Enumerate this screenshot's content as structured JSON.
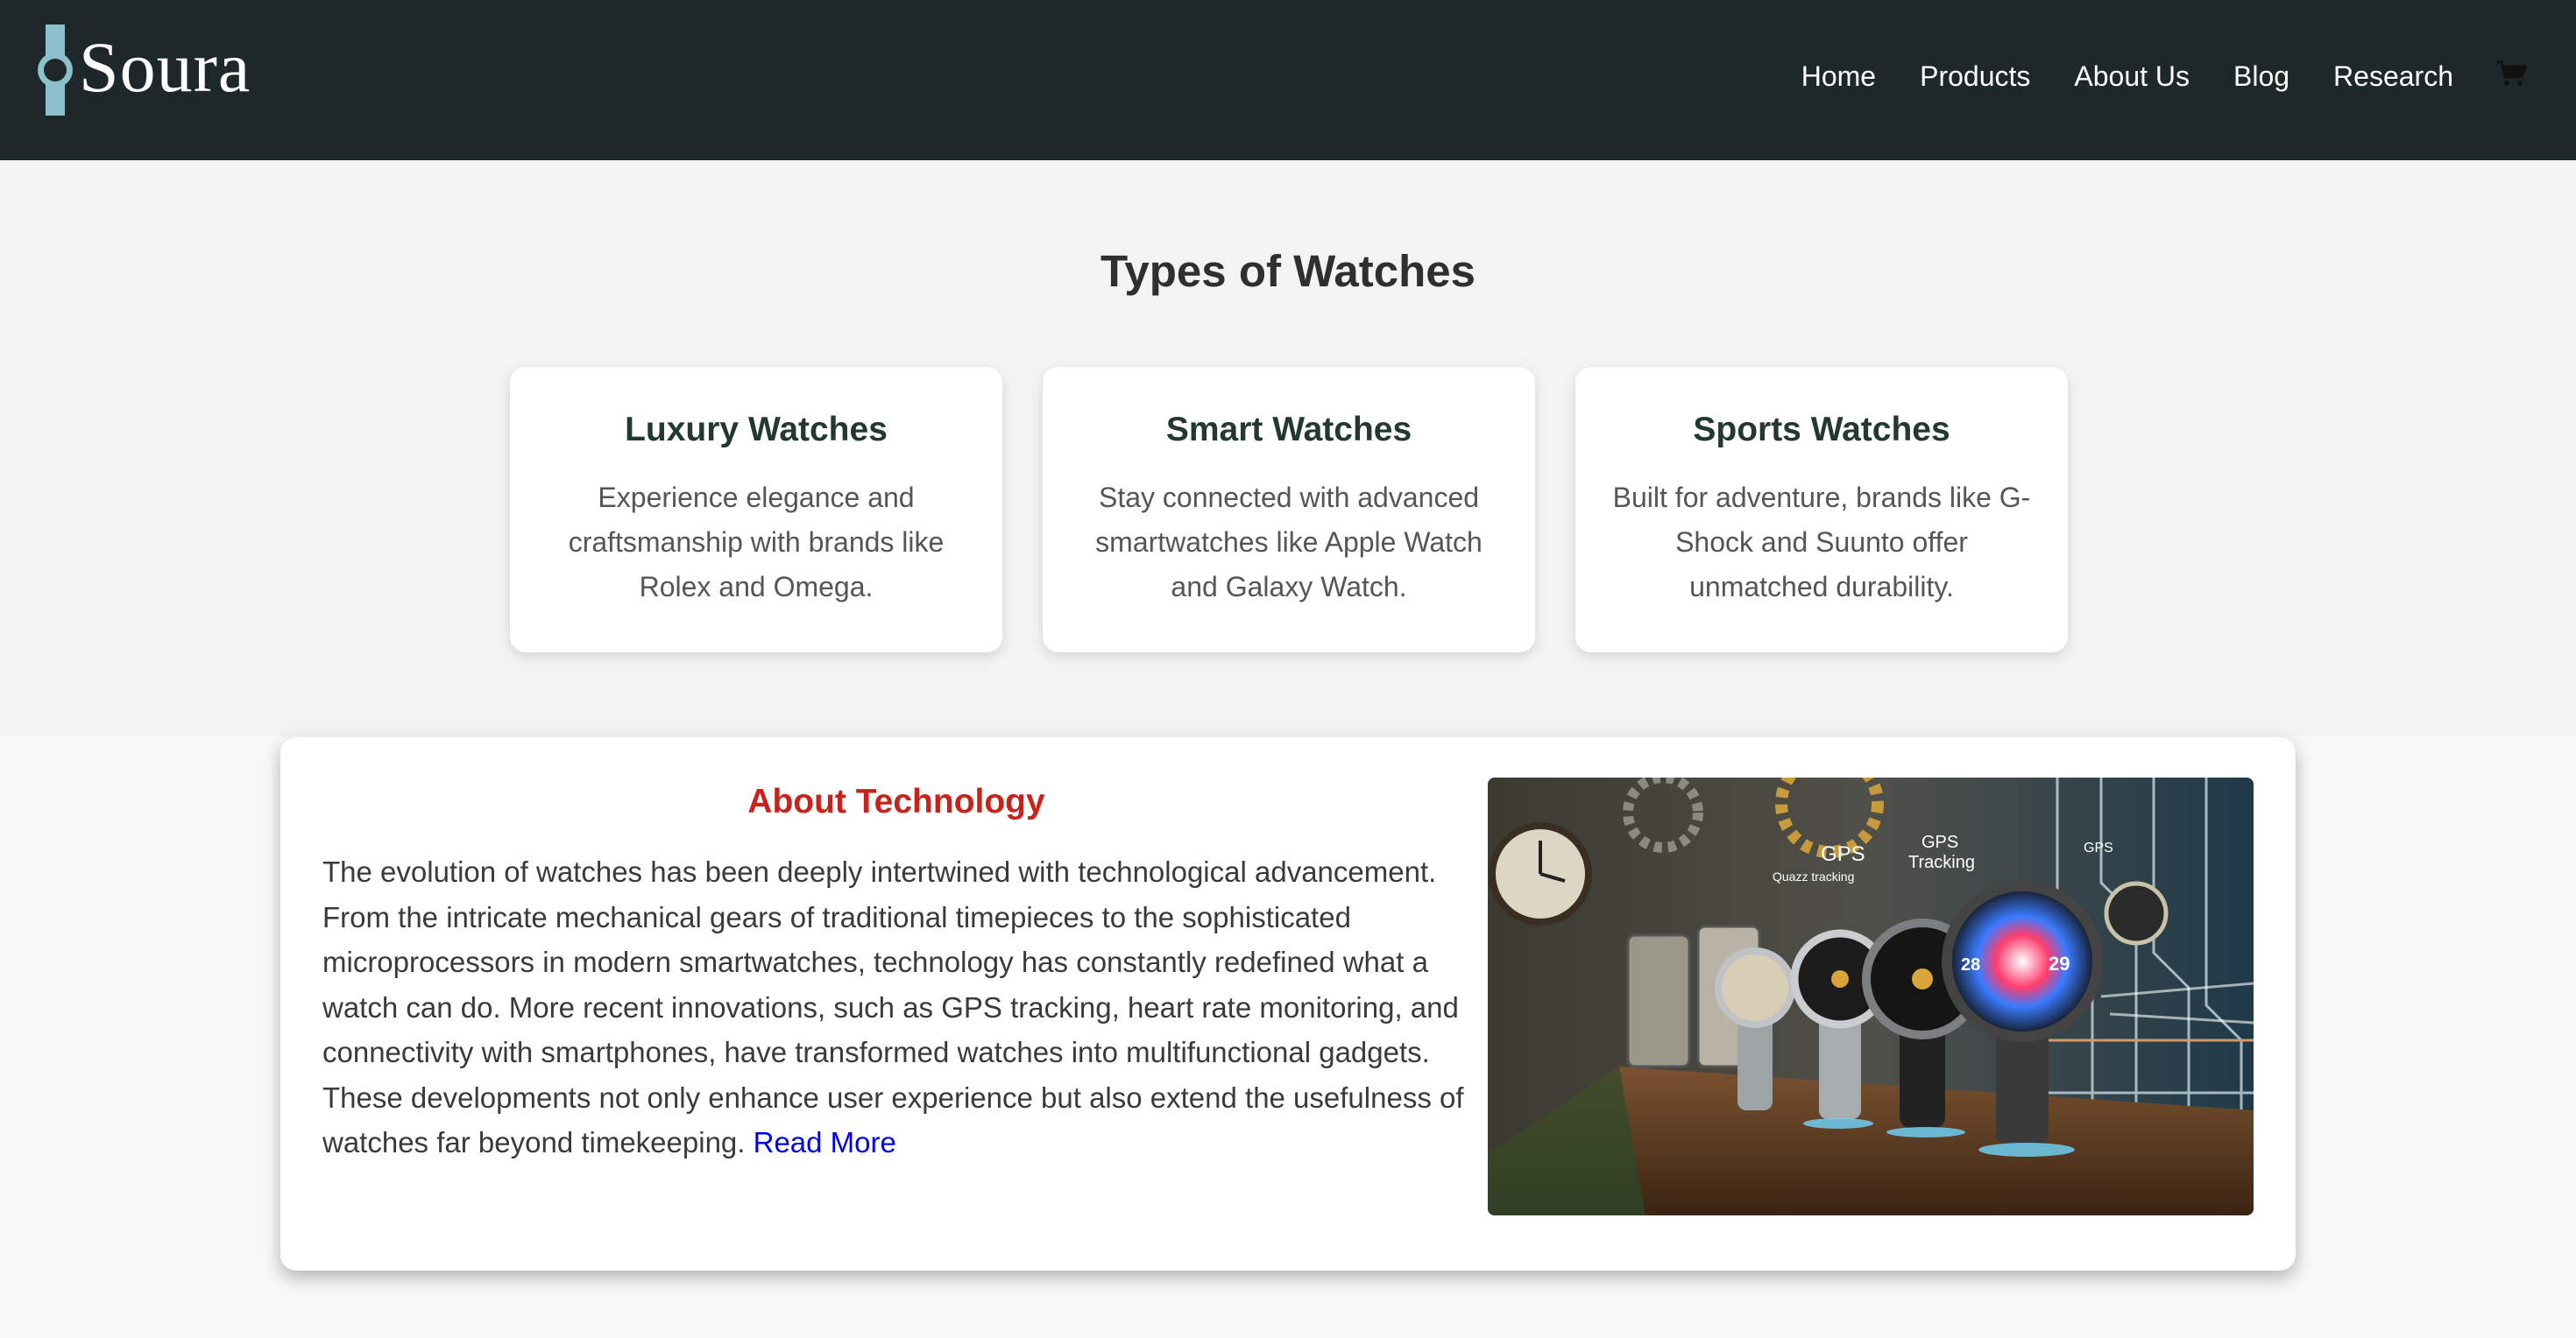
{
  "brand": {
    "name": "Soura",
    "accent": "#8cc1cc"
  },
  "nav": {
    "items": [
      "Home",
      "Products",
      "About Us",
      "Blog",
      "Research"
    ],
    "cart_icon": "shopping-cart-icon"
  },
  "types": {
    "title": "Types of Watches",
    "cards": [
      {
        "title": "Luxury Watches",
        "text": "Experience elegance and craftsmanship with brands like Rolex and Omega."
      },
      {
        "title": "Smart Watches",
        "text": "Stay connected with advanced smartwatches like Apple Watch and Galaxy Watch."
      },
      {
        "title": "Sports Watches",
        "text": "Built for adventure, brands like G-Shock and Suunto offer unmatched durability."
      }
    ]
  },
  "about": {
    "title": "About Technology",
    "text": "The evolution of watches has been deeply intertwined with technological advancement. From the intricate mechanical gears of traditional timepieces to the sophisticated microprocessors in modern smartwatches, technology has constantly redefined what a watch can do. More recent innovations, such as GPS tracking, heart rate monitoring, and connectivity with smartphones, have transformed watches into multifunctional gadgets. These developments not only enhance user experience but also extend the usefulness of watches far beyond timekeeping.",
    "read_more": "Read More",
    "image_labels": {
      "gps": "GPS",
      "gps_sub": "Quazz tracking",
      "gps_tracking_top": "GPS",
      "gps_tracking_bottom": "Tracking",
      "gps_small": "GPS",
      "dial_left": "28",
      "dial_right": "29"
    },
    "colors": {
      "title": "#c8231b",
      "link": "#0000ee"
    }
  }
}
